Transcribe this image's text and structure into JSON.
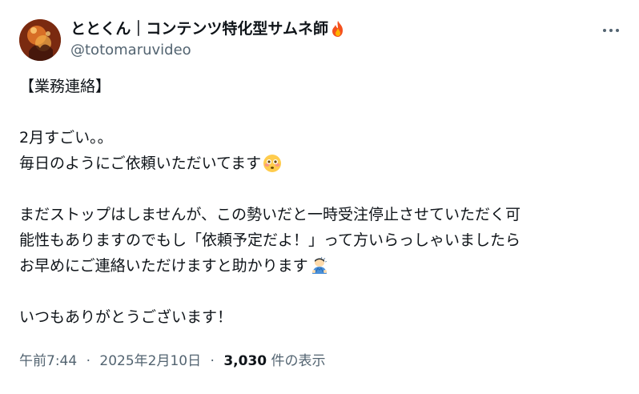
{
  "user": {
    "display_name": "ととくん｜コンテンツ特化型サムネ師",
    "handle": "@totomaruvideo",
    "avatar_icon": "avatar-image",
    "badge_icon": "fire-icon"
  },
  "more_icon": "more-horizontal-icon",
  "post": {
    "line1": "【業務連絡】",
    "line2": "2月すごい。。",
    "line3": "毎日のようにご依頼いただいてます",
    "line3_emoji": "flushed-face-icon",
    "line4": "まだストップはしませんが、この勢いだと一時受注停止させていただく可",
    "line5": "能性もありますのでもし「依頼予定だよ！」って方いらっしゃいましたら",
    "line6": "お早めにご連絡いただけますと助かります",
    "line6_emoji": "person-bowing-icon",
    "line7": "いつもありがとうございます！"
  },
  "meta": {
    "time": "午前7:44",
    "date": "2025年2月10日",
    "views_count": "3,030",
    "views_label": "件の表示",
    "separator": "·"
  },
  "colors": {
    "text": "#0f1419",
    "secondary": "#536471",
    "background": "#ffffff"
  }
}
